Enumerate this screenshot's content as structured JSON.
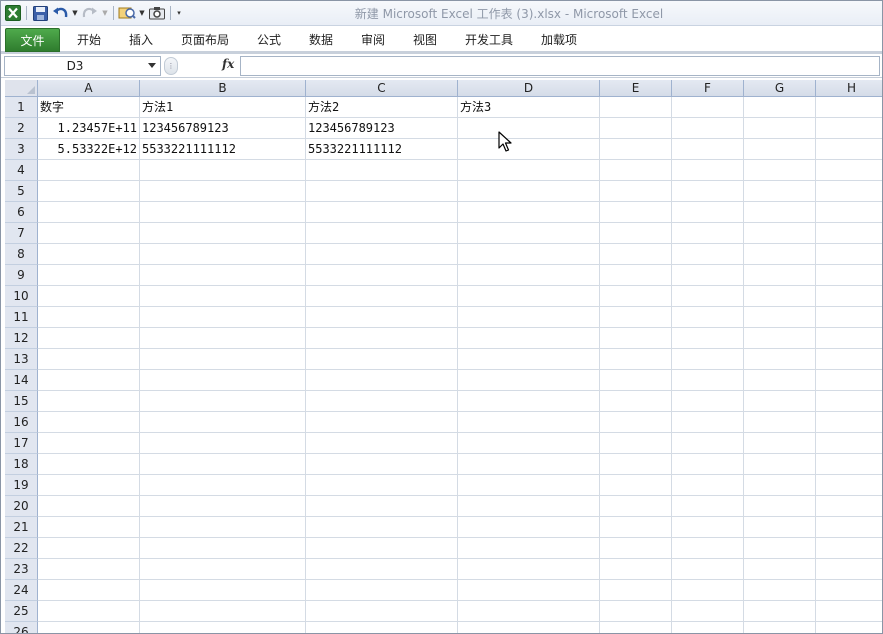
{
  "window": {
    "title": "新建 Microsoft Excel 工作表 (3).xlsx  -  Microsoft Excel"
  },
  "quick_access": {
    "icons": [
      "excel-logo-icon",
      "save-icon",
      "undo-icon",
      "redo-icon",
      "customize-icon",
      "camera-icon"
    ]
  },
  "ribbon": {
    "tabs": [
      {
        "label": "文件"
      },
      {
        "label": "开始"
      },
      {
        "label": "插入"
      },
      {
        "label": "页面布局"
      },
      {
        "label": "公式"
      },
      {
        "label": "数据"
      },
      {
        "label": "审阅"
      },
      {
        "label": "视图"
      },
      {
        "label": "开发工具"
      },
      {
        "label": "加载项"
      }
    ]
  },
  "formula_bar": {
    "name_box": "D3",
    "fx_label": "fx",
    "formula": ""
  },
  "sheet": {
    "columns": [
      "A",
      "B",
      "C",
      "D",
      "E",
      "F",
      "G",
      "H"
    ],
    "rows": [
      "1",
      "2",
      "3",
      "4",
      "5",
      "6",
      "7",
      "8",
      "9",
      "10",
      "11",
      "12",
      "13",
      "14",
      "15",
      "16",
      "17",
      "18",
      "19",
      "20",
      "21",
      "22",
      "23",
      "24",
      "25",
      "26"
    ],
    "cells": {
      "A1": "数字",
      "B1": "方法1",
      "C1": "方法2",
      "D1": "方法3",
      "A2": "1.23457E+11",
      "B2": "123456789123",
      "C2": "123456789123",
      "A3": "5.53322E+12",
      "B3": "5533221111112",
      "C3": "5533221111112"
    }
  },
  "colors": {
    "file_tab": "#3a8f38",
    "header_bg": "#dfe4ee",
    "gridline": "#d4dbe4"
  }
}
